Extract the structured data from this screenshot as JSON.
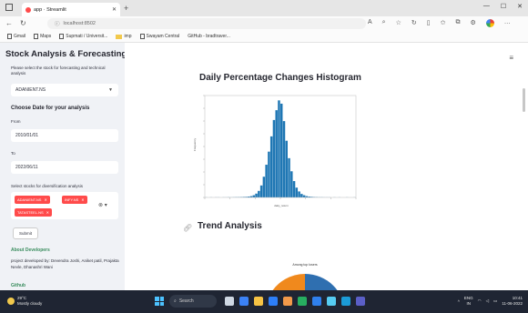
{
  "browser": {
    "tab_title": "app · Streamlit",
    "url": "localhost:8502",
    "bookmarks": [
      "Gmail",
      "Maps",
      "Supmati / Universit...",
      "imp",
      "Swayam Central",
      "GitHub - bradtraver..."
    ]
  },
  "sidebar": {
    "title": "Stock Analysis & Forecasting",
    "stock_prompt": "Please select the stock for forecasting and technical analysis",
    "selected_stock": "ADANIENT.NS",
    "date_heading": "Choose Date for your analysis",
    "from_label": "From",
    "from_value": "2010/01/01",
    "to_label": "To",
    "to_value": "2022/06/11",
    "diversification_label": "Select stocks for diversification analysis",
    "chips": [
      "ADANIENT.NS",
      "INFY.NS",
      "TATASTEEL.NS"
    ],
    "submit_label": "Submit",
    "about_heading": "About Developers",
    "developers_text": "project developed by: Devendra Joshi, Aniket patil, Prajakta Nevle, Dhanashri Wani",
    "github_label": "Github"
  },
  "main": {
    "hist_title": "Daily Percentage Changes Histogram",
    "trend_title": "Trend Analysis",
    "pie_title": "Among top losers"
  },
  "taskbar": {
    "weather_temp": "29°C",
    "weather_desc": "Mostly cloudy",
    "search_placeholder": "Search",
    "lang_top": "ENG",
    "lang_bottom": "IN",
    "time": "10:41",
    "date": "11-06-2022"
  },
  "colors": {
    "bar": "#1f77b4",
    "chip": "#ff4b4b",
    "sidebar_bg": "#f0f2f6",
    "pie_orange": "#f0891d",
    "pie_blue": "#2f6fb0"
  },
  "chart_data": {
    "type": "bar",
    "title": "",
    "xlabel": "daily_return",
    "ylabel": "Frequency",
    "bins": 60,
    "values": [
      1,
      0,
      1,
      0,
      1,
      1,
      0,
      1,
      1,
      2,
      1,
      2,
      3,
      3,
      4,
      5,
      6,
      8,
      12,
      20,
      35,
      60,
      110,
      190,
      300,
      420,
      560,
      710,
      800,
      890,
      860,
      700,
      520,
      360,
      240,
      150,
      90,
      55,
      32,
      20,
      12,
      8,
      6,
      4,
      3,
      2,
      2,
      1,
      1,
      1,
      0,
      1,
      0,
      1,
      0,
      0,
      1,
      0,
      0,
      1
    ]
  }
}
